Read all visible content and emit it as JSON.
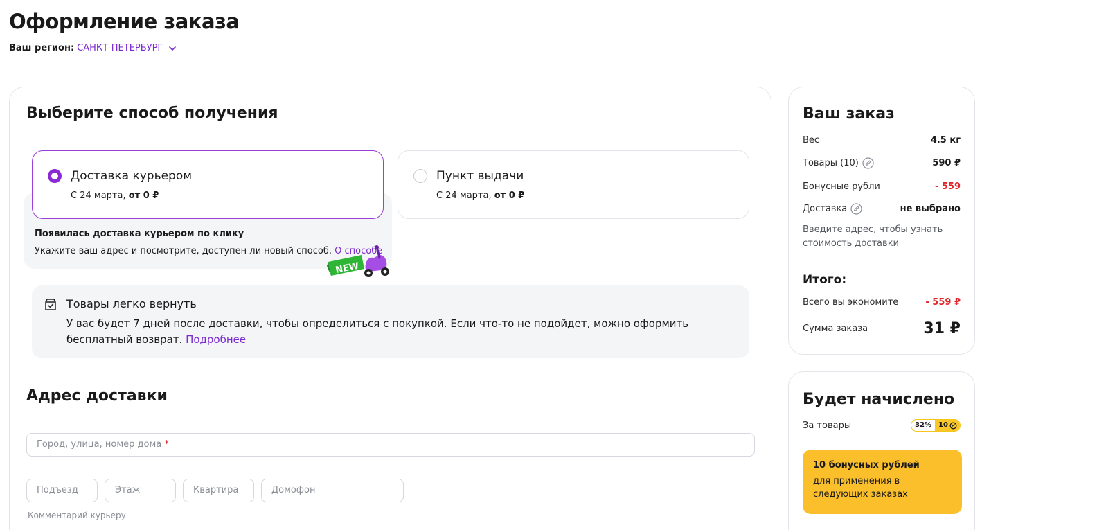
{
  "page": {
    "title": "Оформление заказа",
    "region_label": "Ваш регион:",
    "region_value": "Санкт-Петербург"
  },
  "delivery": {
    "heading": "Выберите способ получения",
    "options": [
      {
        "title": "Доставка курьером",
        "date": "С 24 марта, ",
        "price": "от 0 ₽",
        "selected": true
      },
      {
        "title": "Пункт выдачи",
        "date": "С 24 марта, ",
        "price": "от 0 ₽",
        "selected": false
      }
    ],
    "promo": {
      "title": "Появилась доставка курьером по клику",
      "text": "Укажите ваш адрес и посмотрите, доступен ли новый способ.",
      "link": "О способе",
      "badge": "NEW"
    }
  },
  "returns": {
    "title": "Товары легко вернуть",
    "text": "У вас будет 7 дней после доставки, чтобы определиться с покупкой. Если что-то не подойдет, можно оформить бесплатный возврат.",
    "link": "Подробнее"
  },
  "address": {
    "heading": "Адрес доставки",
    "main_placeholder": "Город, улица, номер дома",
    "required_mark": "*",
    "fields": [
      "Подъезд",
      "Этаж",
      "Квартира",
      "Домофон"
    ],
    "comment_label": "Комментарий курьеру"
  },
  "order": {
    "title": "Ваш заказ",
    "weight_label": "Вес",
    "weight_value": "4.5 кг",
    "items_label": "Товары (10)",
    "items_value": "590 ₽",
    "bonus_label": "Бонусные рубли",
    "bonus_value": "- 559",
    "delivery_label": "Доставка",
    "delivery_value": "не выбрано",
    "delivery_hint": "Введите адрес, чтобы узнать стоимость доставки",
    "total_label": "Итого:",
    "savings_label": "Всего вы экономите",
    "savings_value": "- 559 ₽",
    "sum_label": "Сумма заказа",
    "sum_value": "31 ₽"
  },
  "bonus": {
    "title": "Будет начислено",
    "for_items_label": "За товары",
    "percent": "32%",
    "amount": "10",
    "box_title": "10 бонусных рублей",
    "box_text": "для применения в следующих заказах"
  },
  "colors": {
    "accent": "#8b2bd6",
    "link": "#7b2ccf",
    "negative": "#e0262b",
    "bonus_yellow": "#fbbf2c",
    "new_badge": "#2fb536"
  }
}
